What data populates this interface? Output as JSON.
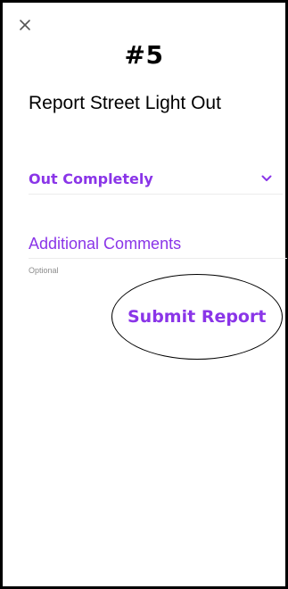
{
  "annotation": {
    "step_label": "#5"
  },
  "header": {
    "close_icon": "close-icon",
    "title": "Report Street Light Out"
  },
  "form": {
    "outage_type": {
      "selected_value": "Out Completely",
      "chevron_icon": "chevron-down-icon"
    },
    "comments": {
      "label": "Additional Comments",
      "helper": "Optional",
      "value": ""
    },
    "submit_label": "Submit Report"
  },
  "colors": {
    "accent": "#8a35e8",
    "text": "#000000",
    "helper": "#8c8c8c",
    "divider": "#ececec",
    "frame_border": "#000000"
  }
}
